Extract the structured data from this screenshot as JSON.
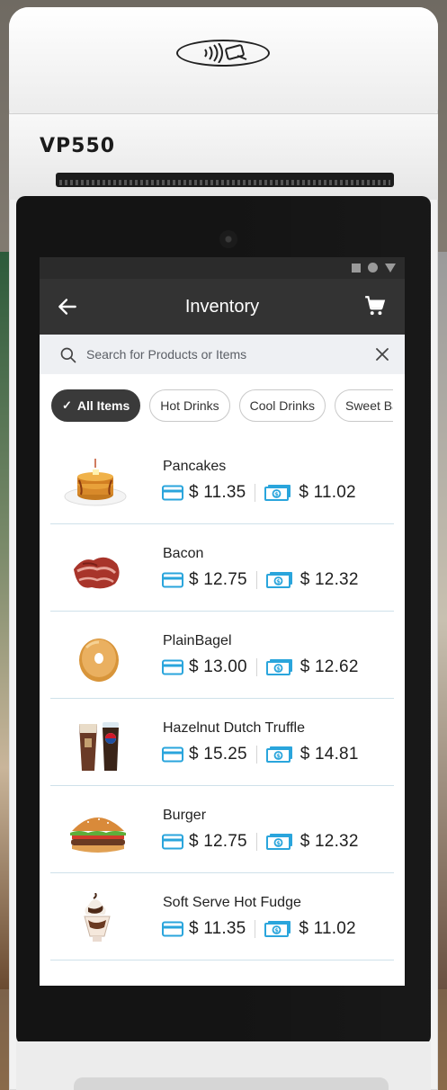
{
  "device": {
    "model": "VP550",
    "nfc_icon": "contactless-payment-icon"
  },
  "status_bar": {
    "icons": [
      "square-icon",
      "circle-icon",
      "triangle-icon"
    ]
  },
  "app_bar": {
    "title": "Inventory",
    "back_icon": "back-arrow-icon",
    "cart_icon": "cart-icon"
  },
  "search": {
    "placeholder": "Search for Products or Items",
    "value": "",
    "clear_icon": "close-icon"
  },
  "filters": [
    {
      "label": "All Items",
      "selected": true
    },
    {
      "label": "Hot Drinks",
      "selected": false
    },
    {
      "label": "Cool Drinks",
      "selected": false
    },
    {
      "label": "Sweet Bal",
      "selected": false
    }
  ],
  "colors": {
    "accent_blue": "#2aa5dc",
    "app_bar": "#333333",
    "status_bar": "#2b2b2b",
    "divider": "#cfe1ea"
  },
  "items": [
    {
      "name": "Pancakes",
      "card_price": "$ 11.35",
      "cash_price": "$ 11.02",
      "image": "pancakes-image"
    },
    {
      "name": "Bacon",
      "card_price": "$ 12.75",
      "cash_price": "$ 12.32",
      "image": "bacon-image"
    },
    {
      "name": "PlainBagel",
      "card_price": "$ 13.00",
      "cash_price": "$ 12.62",
      "image": "bagel-image"
    },
    {
      "name": "Hazelnut Dutch Truffle",
      "card_price": "$ 15.25",
      "cash_price": "$ 14.81",
      "image": "drinks-image"
    },
    {
      "name": "Burger",
      "card_price": "$ 12.75",
      "cash_price": "$ 12.32",
      "image": "burger-image"
    },
    {
      "name": "Soft Serve Hot Fudge",
      "card_price": "$ 11.35",
      "cash_price": "$ 11.02",
      "image": "sundae-image"
    }
  ]
}
